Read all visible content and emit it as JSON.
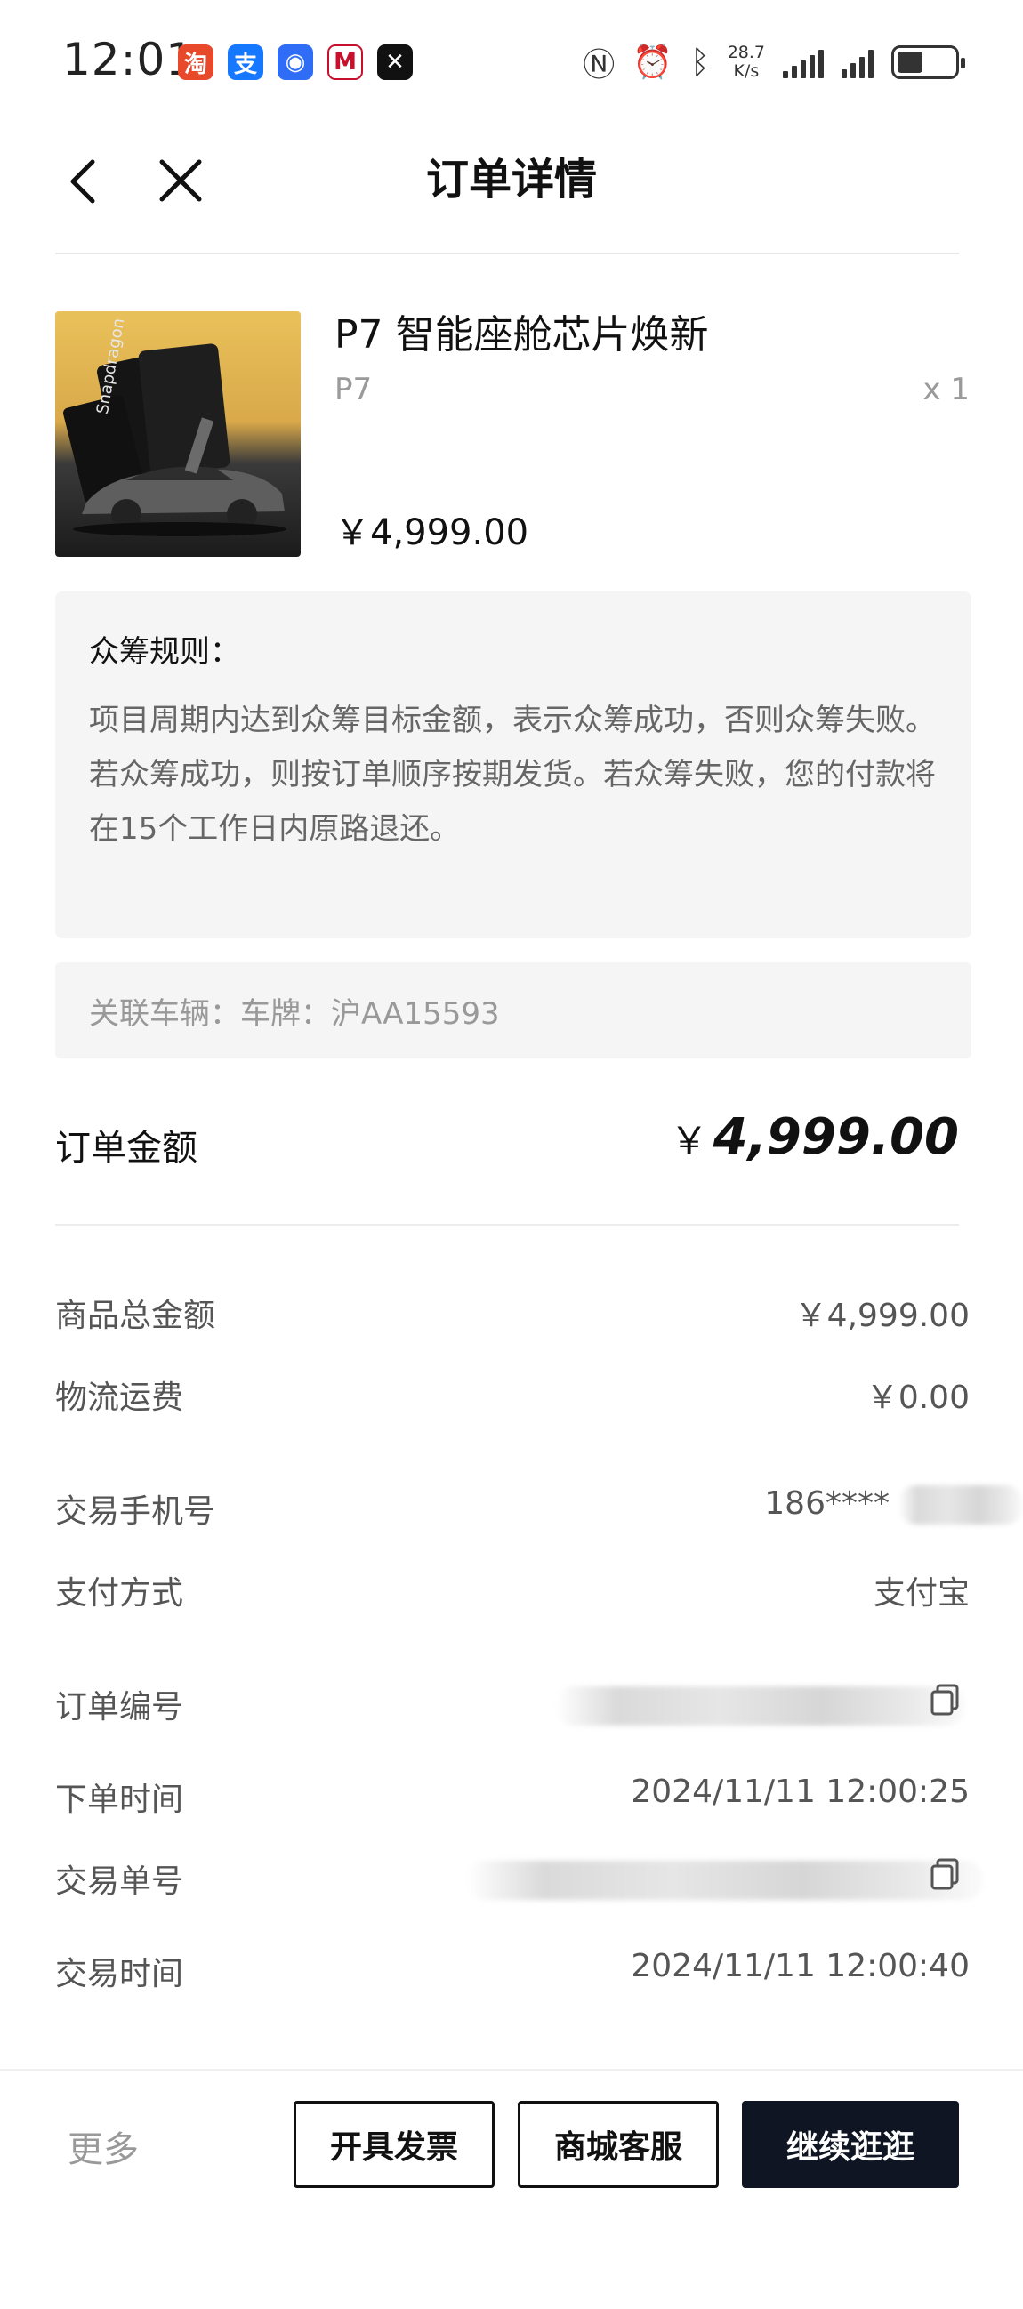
{
  "status_bar": {
    "time": "12:01",
    "net_speed_value": "28.7",
    "net_speed_unit": "K/s",
    "apps": [
      {
        "name": "taobao-app-icon",
        "glyph": "淘",
        "color": "#e8492b"
      },
      {
        "name": "alipay-app-icon",
        "glyph": "支",
        "color": "#1677ff"
      },
      {
        "name": "blue-app-icon",
        "glyph": "◉",
        "color": "#2f6df6"
      },
      {
        "name": "cmb-app-icon",
        "glyph": "M",
        "color": "#ffffff"
      },
      {
        "name": "capcut-app-icon",
        "glyph": "✕",
        "color": "#111111"
      }
    ]
  },
  "nav": {
    "title": "订单详情"
  },
  "product": {
    "name": "P7 智能座舱芯片焕新",
    "variant": "P7",
    "quantity": "x 1",
    "price": "￥4,999.00"
  },
  "rules": {
    "title": "众筹规则：",
    "line1": "项目周期内达到众筹目标金额，表示众筹成功，否则众筹失败。",
    "line2": "若众筹成功，则按订单顺序按期发货。若众筹失败，您的付款将在15个工作日内原路退还。"
  },
  "vehicle": {
    "text": "关联车辆：车牌：沪AA15593"
  },
  "amount": {
    "label": "订单金额",
    "currency": "￥",
    "value": "4,999.00"
  },
  "details": {
    "goods_total_label": "商品总金额",
    "goods_total_value": "￥4,999.00",
    "shipping_label": "物流运费",
    "shipping_value": "￥0.00",
    "phone_label": "交易手机号",
    "phone_value": "186****",
    "payment_label": "支付方式",
    "payment_value": "支付宝",
    "order_no_label": "订单编号",
    "order_time_label": "下单时间",
    "order_time_value": "2024/11/11 12:00:25",
    "trade_no_label": "交易单号",
    "trade_time_label": "交易时间",
    "trade_time_value": "2024/11/11 12:00:40"
  },
  "bottom": {
    "more": "更多",
    "invoice": "开具发票",
    "service": "商城客服",
    "continue": "继续逛逛"
  }
}
